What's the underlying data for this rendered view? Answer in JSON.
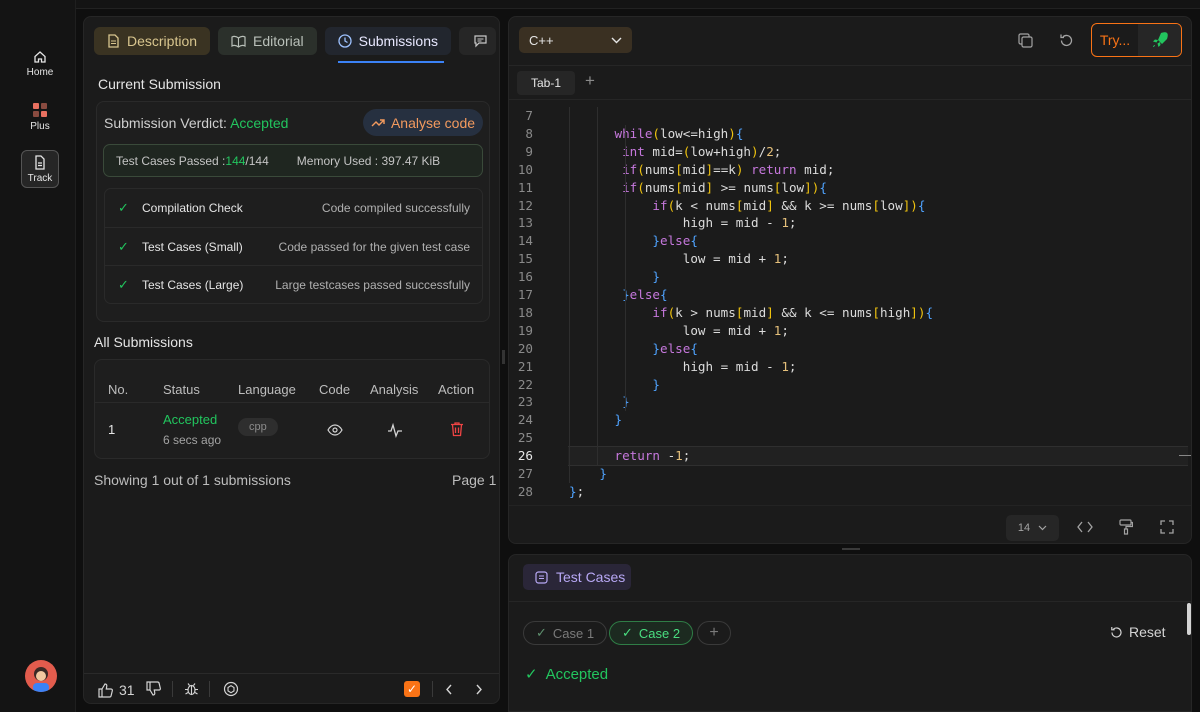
{
  "sidebar": {
    "items": [
      {
        "label": "Home",
        "icon": "home-icon"
      },
      {
        "label": "Plus",
        "icon": "plus-grid-icon"
      },
      {
        "label": "Track",
        "icon": "document-icon"
      }
    ]
  },
  "left_tabs": [
    {
      "label": "Description",
      "icon": "document-icon"
    },
    {
      "label": "Editorial",
      "icon": "book-icon"
    },
    {
      "label": "Submissions",
      "icon": "clock-icon"
    },
    {
      "label": "",
      "icon": "chat-icon"
    }
  ],
  "current": {
    "heading": "Current Submission",
    "verdict_label": "Submission Verdict: ",
    "verdict": "Accepted",
    "analyse_label": "Analyse code",
    "tests_label": "Test Cases Passed : ",
    "tests_passed": "144",
    "tests_total": "/144",
    "memory": "Memory Used : 397.47 KiB",
    "checks": [
      {
        "label": "Compilation Check",
        "value": "Code compiled successfully"
      },
      {
        "label": "Test Cases (Small)",
        "value": "Code passed for the given test case"
      },
      {
        "label": "Test Cases (Large)",
        "value": "Large testcases passed successfully"
      }
    ]
  },
  "all": {
    "heading": "All Submissions",
    "columns": [
      "No.",
      "Status",
      "Language",
      "Code",
      "Analysis",
      "Action"
    ],
    "rows": [
      {
        "no": "1",
        "status": "Accepted",
        "time": "6 secs ago",
        "lang": "cpp"
      }
    ],
    "footer_left": "Showing 1 out of 1 submissions",
    "footer_right": "Page 1"
  },
  "bottom_bar": {
    "likes": "31"
  },
  "editor": {
    "language": "C++",
    "try_label": "Try...",
    "tab": "Tab-1",
    "font_size": "14",
    "colors": {
      "accent": "#f97316",
      "rocket": "#22c55e"
    }
  },
  "code_lines": [
    {
      "n": "7",
      "text": ""
    },
    {
      "n": "8",
      "text": "      while(low<=high){"
    },
    {
      "n": "9",
      "text": "       int mid=(low+high)/2;"
    },
    {
      "n": "10",
      "text": "       if(nums[mid]==k) return mid;"
    },
    {
      "n": "11",
      "text": "       if(nums[mid] >= nums[low]){"
    },
    {
      "n": "12",
      "text": "           if(k < nums[mid] && k >= nums[low]){"
    },
    {
      "n": "13",
      "text": "               high = mid - 1;"
    },
    {
      "n": "14",
      "text": "           }else{"
    },
    {
      "n": "15",
      "text": "               low = mid + 1;"
    },
    {
      "n": "16",
      "text": "           }"
    },
    {
      "n": "17",
      "text": "       }else{"
    },
    {
      "n": "18",
      "text": "           if(k > nums[mid] && k <= nums[high]){"
    },
    {
      "n": "19",
      "text": "               low = mid + 1;"
    },
    {
      "n": "20",
      "text": "           }else{"
    },
    {
      "n": "21",
      "text": "               high = mid - 1;"
    },
    {
      "n": "22",
      "text": "           }"
    },
    {
      "n": "23",
      "text": "       }"
    },
    {
      "n": "24",
      "text": "      }"
    },
    {
      "n": "25",
      "text": ""
    },
    {
      "n": "26",
      "text": "      return -1;"
    },
    {
      "n": "27",
      "text": "    }"
    },
    {
      "n": "28",
      "text": "};"
    }
  ],
  "tests": {
    "title": "Test Cases",
    "cases": [
      "Case 1",
      "Case 2"
    ],
    "reset": "Reset",
    "result": "Accepted"
  }
}
